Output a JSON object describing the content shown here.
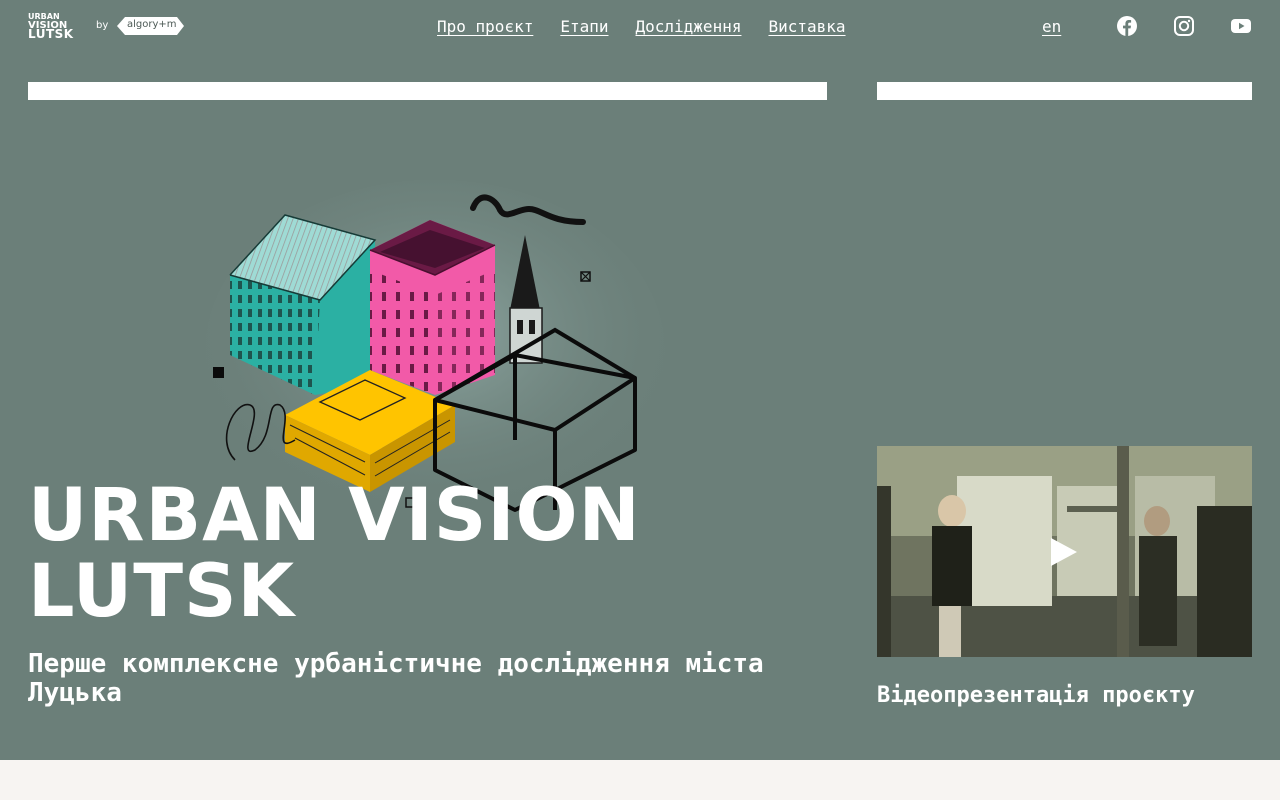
{
  "brand": {
    "logo_line1": "URBAN",
    "logo_line2": "VISION",
    "logo_line3": "LUTSK",
    "by": "by",
    "partner": "algory+m"
  },
  "nav": {
    "items": [
      {
        "label": "Про проєкт"
      },
      {
        "label": "Етапи"
      },
      {
        "label": "Дослідження"
      },
      {
        "label": "Виставка"
      }
    ],
    "lang": "en"
  },
  "social": [
    "facebook-icon",
    "instagram-icon",
    "youtube-icon"
  ],
  "hero": {
    "title_line1": "URBAN VISION",
    "title_line2": "LUTSK",
    "subtitle": "Перше комплексне урбаністичне дослідження міста Луцька"
  },
  "video": {
    "caption": "Відеопрезентація проєкту"
  },
  "colors": {
    "hero_bg": "#6b7f79",
    "page_bg": "#f7f4f2",
    "accent_pink": "#f25aa8",
    "accent_teal": "#2bb0a3",
    "accent_yellow": "#ffc400"
  }
}
